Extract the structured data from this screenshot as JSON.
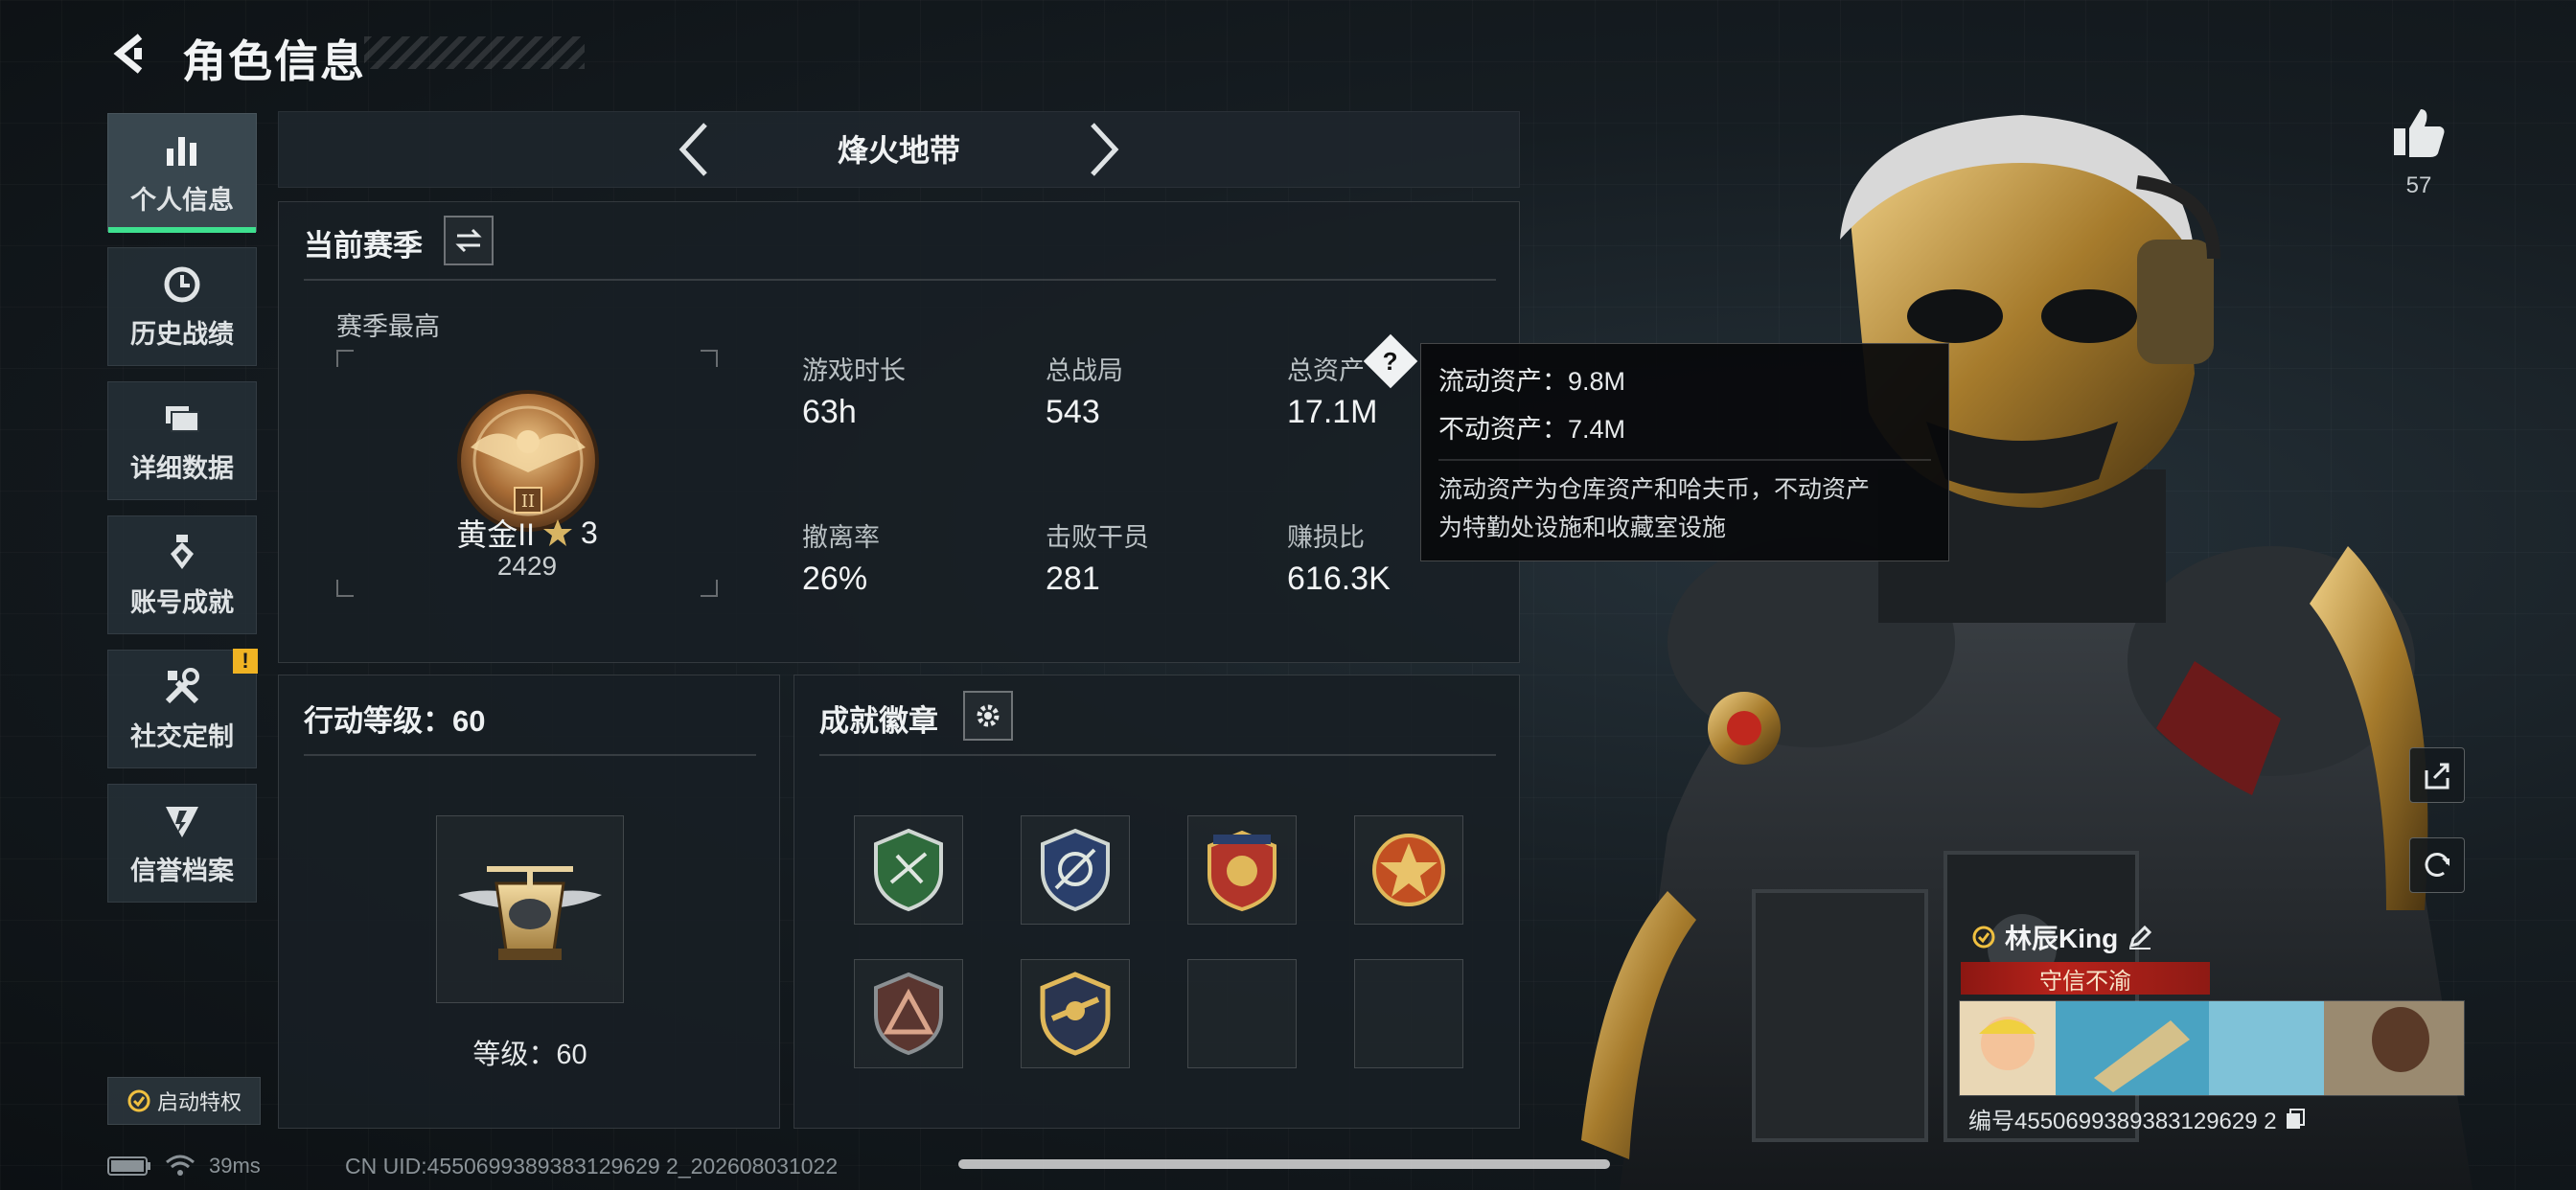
{
  "header": {
    "title": "角色信息"
  },
  "sidebar": {
    "items": [
      {
        "label": "个人信息",
        "icon": "bar-chart-icon",
        "active": true
      },
      {
        "label": "历史战绩",
        "icon": "history-clock-icon"
      },
      {
        "label": "详细数据",
        "icon": "folder-data-icon"
      },
      {
        "label": "账号成就",
        "icon": "achievement-medal-icon"
      },
      {
        "label": "社交定制",
        "icon": "tools-icon",
        "badge": "!"
      },
      {
        "label": "信誉档案",
        "icon": "reputation-icon"
      }
    ],
    "privilege_label": "启动特权"
  },
  "mode_selector": {
    "title": "烽火地带"
  },
  "season": {
    "title": "当前赛季",
    "best_label": "赛季最高",
    "rank_name": "黄金II",
    "rank_stars": "3",
    "rank_score": "2429",
    "stats": [
      {
        "label": "游戏时长",
        "value": "63h"
      },
      {
        "label": "总战局",
        "value": "543"
      },
      {
        "label": "总资产",
        "value": "17.1M"
      },
      {
        "label": "撤离率",
        "value": "26%"
      },
      {
        "label": "击败干员",
        "value": "281"
      },
      {
        "label": "赚损比",
        "value": "616.3K"
      }
    ]
  },
  "tooltip": {
    "liquid": "流动资产：9.8M",
    "fixed": "不动资产：7.4M",
    "note_line1": "流动资产为仓库资产和哈夫币，不动资产",
    "note_line2": "为特勤处设施和收藏室设施"
  },
  "action_level": {
    "title": "行动等级：60",
    "level_label": "等级：60"
  },
  "badges": {
    "title": "成就徽章",
    "items": [
      "green-shield-badge",
      "blue-shield-badge",
      "red-star-badge",
      "orange-star-badge",
      "triangle-badge",
      "gold-wing-badge",
      "empty",
      "empty"
    ]
  },
  "social": {
    "like_count": "57"
  },
  "player": {
    "name": "林辰King",
    "title": "守信不渝",
    "id_text": "编号4550699389383129629 2"
  },
  "status": {
    "ping": "39ms",
    "uid": "CN UID:4550699389383129629 2_202608031022"
  },
  "colors": {
    "accent_green": "#3ee08f",
    "warn": "#f0b323",
    "title_red": "#b7231b",
    "gold": "#c9a24a"
  }
}
